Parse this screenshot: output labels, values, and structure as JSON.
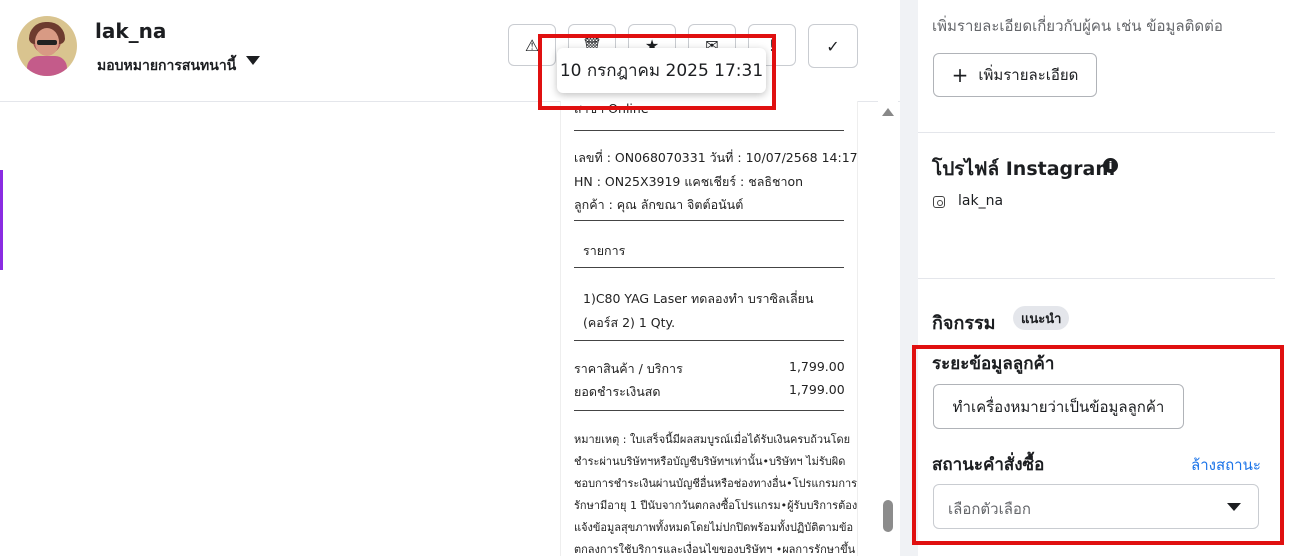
{
  "header": {
    "username": "lak_na",
    "assign_label": "มอบหมายการสนทนานี้",
    "toolbar_icons": [
      "warning-icon",
      "trash-icon",
      "star-icon",
      "mail-icon",
      "exclamation-icon",
      "check-icon"
    ],
    "toolbar_glyphs": [
      "⚠",
      "🗑",
      "★",
      "✉",
      "!",
      "✓"
    ],
    "tooltip": "10 กรกฎาคม 2025 17:31"
  },
  "receipt": {
    "lines": [
      "สาขา Online",
      "เลขที่ : ON068070331 วันที่ : 10/07/2568 14:17",
      "HN : ON25X3919        แคชเชียร์ : ชลธิชาon",
      "ลูกค้า : คุณ ลักขณา จิตต์อนันต์",
      "รายการ",
      "1)C80 YAG Laser ทดลองทำ บราซิลเลี่ยน",
      "(คอร์ส 2) 1 Qty.",
      "ราคาสินค้า / บริการ",
      "1,799.00",
      "ยอดชำระเงินสด",
      "1,799.00",
      "หมายเหตุ : ใบเสร็จนี้มีผลสมบูรณ์เมื่อได้รับเงินครบถ้วนโดย",
      "ชำระผ่านบริษัทฯหรือบัญชีบริษัทฯเท่านั้น•บริษัทฯ ไม่รับผิด",
      "ชอบการชำระเงินผ่านบัญชีอื่นหรือช่องทางอื่น•โปรแกรมการ",
      "รักษามีอายุ 1 ปีนับจากวันตกลงซื้อโปรแกรม•ผู้รับบริการต้อง",
      "แจ้งข้อมูลสุขภาพทั้งหมดโดยไม่ปกปิดพร้อมทั้งปฏิบัติตามข้อ",
      "ตกลงการใช้บริการและเงื่อนไขของบริษัทฯ •ผลการรักษาขึ้น"
    ]
  },
  "sidebar": {
    "description": "เพิ่มรายละเอียดเกี่ยวกับผู้คน เช่น ข้อมูลติดต่อ",
    "add_details_label": "เพิ่มรายละเอียด",
    "instagram_title": "โปรไฟล์ Instagram",
    "instagram_handle": "lak_na",
    "activity_title": "กิจกรรม",
    "activity_badge": "แนะนำ",
    "lead_stage_title": "ระยะข้อมูลลูกค้า",
    "mark_lead_label": "ทำเครื่องหมายว่าเป็นข้อมูลลูกค้า",
    "order_status_title": "สถานะคำสั่งซื้อ",
    "clear_status_label": "ล้างสถานะ",
    "select_placeholder": "เลือกตัวเลือก"
  },
  "colors": {
    "highlight": "#e01010",
    "link": "#1a73e8",
    "accent_bar": "#8a2be2"
  }
}
